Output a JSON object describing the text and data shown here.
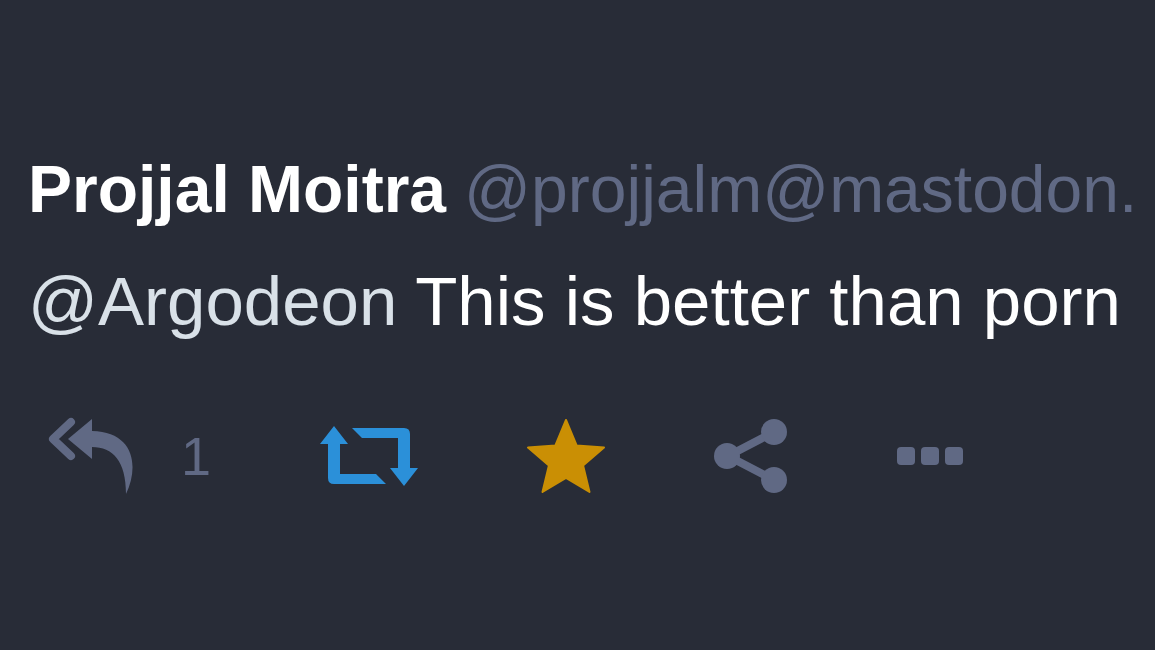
{
  "status": {
    "display_name": "Projjal Moitra",
    "account": "@projjalm@mastodon.",
    "content": {
      "mention": "@Argodeon",
      "text": "This is better than porn"
    },
    "actions": [
      {
        "kind": "reply",
        "count": "1"
      },
      {
        "kind": "boost",
        "active": true
      },
      {
        "kind": "favourite",
        "active": true
      },
      {
        "kind": "share"
      },
      {
        "kind": "more"
      }
    ]
  }
}
